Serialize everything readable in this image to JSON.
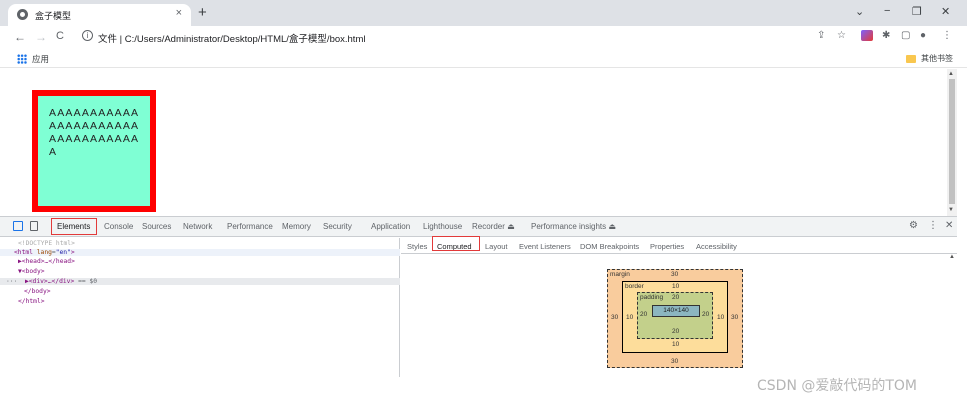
{
  "browser": {
    "tab_title": "盒子模型",
    "tab_close": "×",
    "new_tab": "+",
    "window_controls": [
      "⌄",
      "−",
      "❐",
      "✕"
    ],
    "nav": {
      "back": "←",
      "forward": "→",
      "reload": "C"
    },
    "url_prefix": "文件 |",
    "url": "C:/Users/Administrator/Desktop/HTML/盒子模型/box.html",
    "toolbar_icons": [
      "⇪",
      "☆",
      "✱",
      "▢",
      "●",
      "⋮"
    ],
    "apps_label": "应用",
    "other_bookmarks": "其他书签"
  },
  "page": {
    "box_text": "AAAAAAAAAAAAAAAAAAAAAAAAAAAAAAAAAA",
    "box_border_color": "#ff0000",
    "box_background": "#7fffd4"
  },
  "devtools": {
    "tabs": [
      "Elements",
      "Console",
      "Sources",
      "Network",
      "Performance",
      "Memory",
      "Security",
      "Application",
      "Lighthouse",
      "Recorder ⏏",
      "Performance insights ⏏"
    ],
    "active_tab": "Elements",
    "settings_icon": "⚙",
    "more_icon": "⋮",
    "close_icon": "✕",
    "dom": {
      "doctype": "<!DOCTYPE html>",
      "html_open": "<html ",
      "lang_attr": "lang",
      "lang_val": "\"en\"",
      "html_close_bracket": ">",
      "head": "▶<head>…</head>",
      "body_open": "▼<body>",
      "div_prefix": "···",
      "div": "▶<div>…</div>",
      "div_suffix": "== $0",
      "body_close": "</body>",
      "html_close": "</html>"
    },
    "side_tabs": [
      "Styles",
      "Computed",
      "Layout",
      "Event Listeners",
      "DOM Breakpoints",
      "Properties",
      "Accessibility"
    ],
    "active_side_tab": "Computed",
    "box_model": {
      "margin_label": "margin",
      "border_label": "border",
      "padding_label": "padding",
      "margin": {
        "top": "30",
        "right": "30",
        "bottom": "30",
        "left": "30"
      },
      "border": {
        "top": "10",
        "right": "10",
        "bottom": "10",
        "left": "10"
      },
      "padding": {
        "top": "20",
        "right": "20",
        "bottom": "20",
        "left": "20"
      },
      "content": "140×140",
      "colors": {
        "margin": "#f9cc9d",
        "border": "#fddd9b",
        "padding": "#c3d08b",
        "content": "#8cb6c0"
      }
    }
  },
  "watermark": "CSDN @爱敲代码的TOM"
}
